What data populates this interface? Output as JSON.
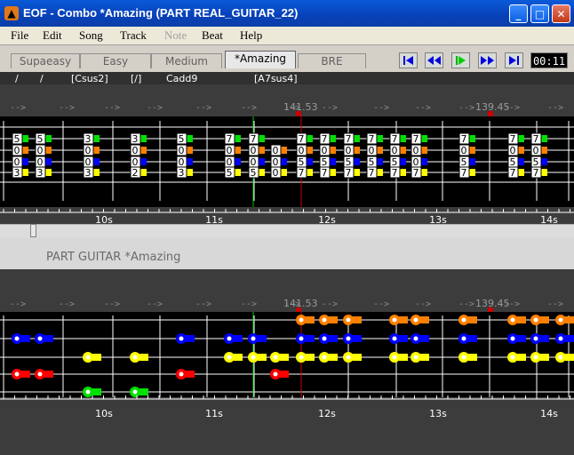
{
  "window": {
    "title": "EOF - Combo  *Amazing (PART REAL_GUITAR_22)",
    "app_icon": "flame-icon"
  },
  "menu": [
    "File",
    "Edit",
    "Song",
    "Track",
    "Note",
    "Beat",
    "Help"
  ],
  "menu_disabled": [
    "Note"
  ],
  "difficulty_tabs": [
    {
      "label": "Supaeasy",
      "active": false
    },
    {
      "label": "Easy",
      "active": false
    },
    {
      "label": "Medium",
      "active": false
    },
    {
      "label": "*Amazing",
      "active": true
    },
    {
      "label": "BRE",
      "active": false
    }
  ],
  "playback_controls": [
    "rewind-to-start-icon",
    "rewind-icon",
    "play-icon",
    "fast-forward-icon",
    "skip-to-end-icon"
  ],
  "time_display": "00:11",
  "chord_names": [
    "/",
    "/",
    "[Csus2]",
    "[/]",
    "Cadd9",
    "[A7sus4]"
  ],
  "tempo_markers": [
    "141.53",
    "139.45"
  ],
  "beat_marker_text": "-->",
  "time_labels": [
    "10s",
    "11s",
    "12s",
    "13s",
    "14s"
  ],
  "lower_panel_label": "PART GUITAR   *Amazing",
  "colors": {
    "lane_colors": [
      "#00e000",
      "#ff0000",
      "#ffff00",
      "#0000ff",
      "#ff8000"
    ],
    "highlight_line": "#00c000",
    "tempo_marker": "#cc0000",
    "fret_bg": "#ffffff"
  },
  "pro_notes": [
    {
      "frets": [
        "5",
        "0",
        "0",
        "3"
      ]
    },
    {
      "frets": [
        "5",
        "0",
        "0",
        "3"
      ]
    },
    {
      "frets": [
        "3",
        "0",
        "0",
        "3"
      ]
    },
    {
      "frets": [
        "3",
        "0",
        "0",
        "2"
      ]
    },
    {
      "frets": [
        "5",
        "0",
        "0",
        "3"
      ]
    },
    {
      "frets": [
        "7",
        "0",
        "0",
        "5"
      ]
    },
    {
      "frets": [
        "7",
        "0",
        "0",
        "5"
      ]
    },
    {
      "frets": [
        "",
        "0",
        "0",
        "0"
      ]
    },
    {
      "frets": [
        "7",
        "0",
        "5",
        "7"
      ]
    },
    {
      "frets": [
        "7",
        "0",
        "5",
        "7"
      ]
    },
    {
      "frets": [
        "7",
        "0",
        "5",
        "7"
      ]
    },
    {
      "frets": [
        "7",
        "0",
        "5",
        "7"
      ]
    },
    {
      "frets": [
        "7",
        "0",
        "5",
        "7"
      ]
    },
    {
      "frets": [
        "7",
        "0",
        "0",
        "7"
      ]
    },
    {
      "frets": [
        "7",
        "0",
        "5",
        "7"
      ]
    },
    {
      "frets": [
        "7",
        "0",
        "5",
        "7"
      ]
    },
    {
      "frets": [
        "7",
        "0",
        "5",
        "7"
      ]
    }
  ]
}
